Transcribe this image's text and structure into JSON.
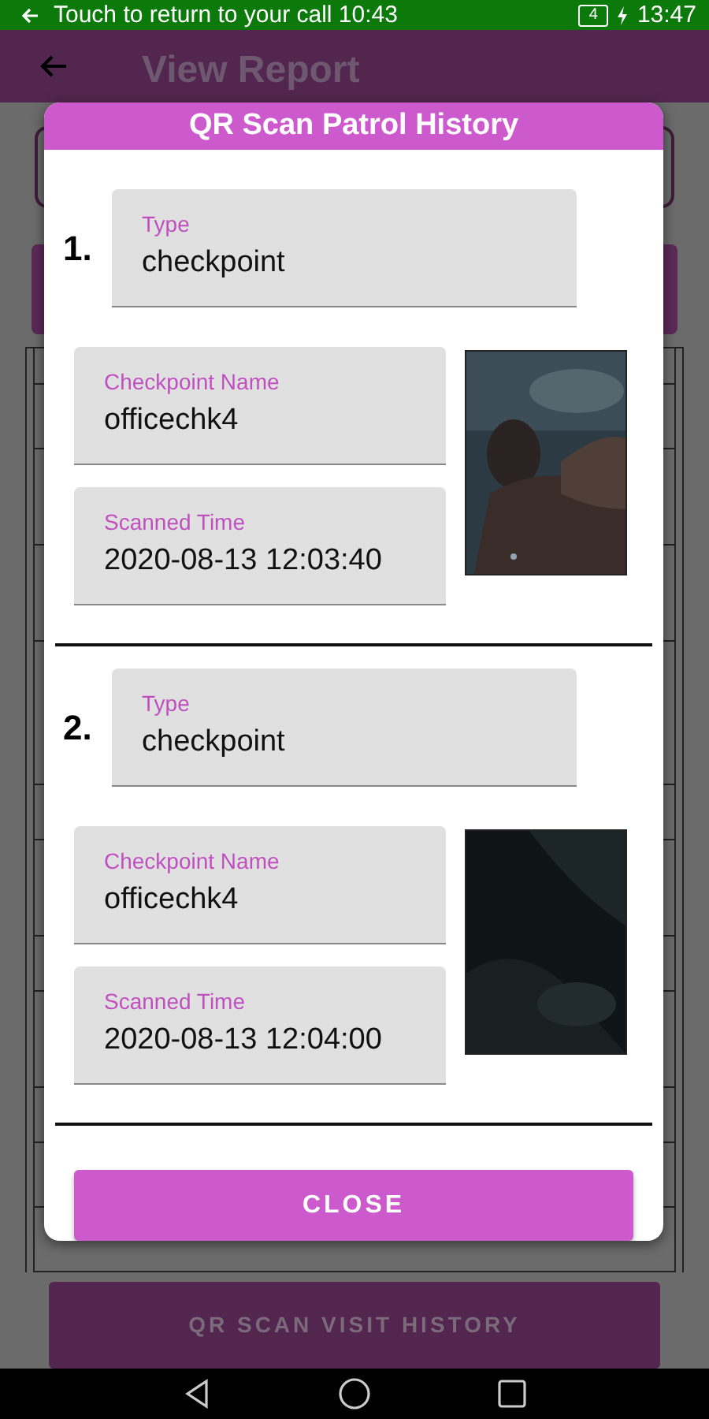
{
  "status_bar": {
    "call_text": "Touch to return to your call 10:43",
    "battery": "4",
    "time": "13:47"
  },
  "app_bar": {
    "title": "View Report"
  },
  "dialog": {
    "title": "QR Scan Patrol History",
    "entries": [
      {
        "number": "1.",
        "type_label": "Type",
        "type": "checkpoint",
        "name_label": "Checkpoint Name",
        "name": "officechk4",
        "time_label": "Scanned Time",
        "time": "2020-08-13 12:03:40"
      },
      {
        "number": "2.",
        "type_label": "Type",
        "type": "checkpoint",
        "name_label": "Checkpoint Name",
        "name": "officechk4",
        "time_label": "Scanned Time",
        "time": "2020-08-13 12:04:00"
      }
    ],
    "close_button": "CLOSE"
  },
  "visit_history_button": "QR SCAN VISIT HISTORY"
}
